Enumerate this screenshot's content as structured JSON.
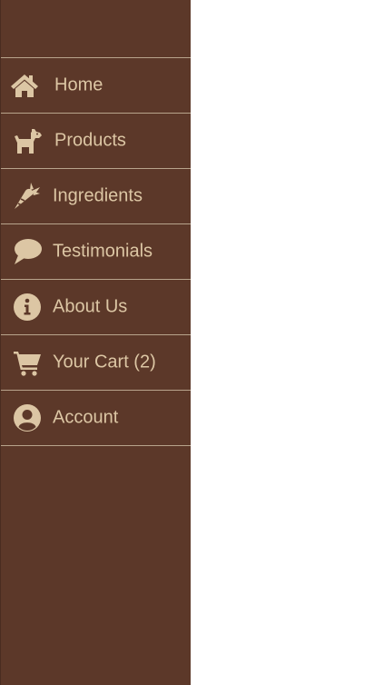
{
  "theme": {
    "sidebar_bg": "#5c3829",
    "text_color": "#dcc6a4",
    "divider_color": "#b8a48c",
    "page_bg": "#ffffff"
  },
  "nav": {
    "items": [
      {
        "label": "Home",
        "icon": "home-icon"
      },
      {
        "label": "Products",
        "icon": "dog-icon"
      },
      {
        "label": "Ingredients",
        "icon": "carrot-icon"
      },
      {
        "label": "Testimonials",
        "icon": "speech-bubble-icon"
      },
      {
        "label": "About Us",
        "icon": "info-icon"
      },
      {
        "label": "Your Cart (2)",
        "icon": "cart-icon"
      },
      {
        "label": "Account",
        "icon": "user-circle-icon"
      }
    ]
  }
}
